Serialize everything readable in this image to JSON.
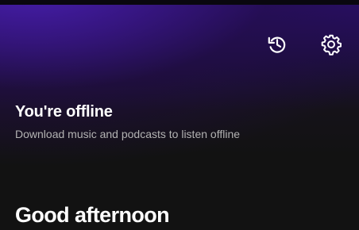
{
  "theme": {
    "accent": "#4b1fb2",
    "background": "#121212",
    "text_primary": "#ffffff",
    "text_secondary": "#b3b3b3"
  },
  "toolbar": {
    "icons": [
      "history-icon",
      "gear-icon"
    ]
  },
  "offline": {
    "title": "You're offline",
    "subtitle": "Download music and podcasts to listen offline"
  },
  "home": {
    "greeting": "Good afternoon"
  }
}
